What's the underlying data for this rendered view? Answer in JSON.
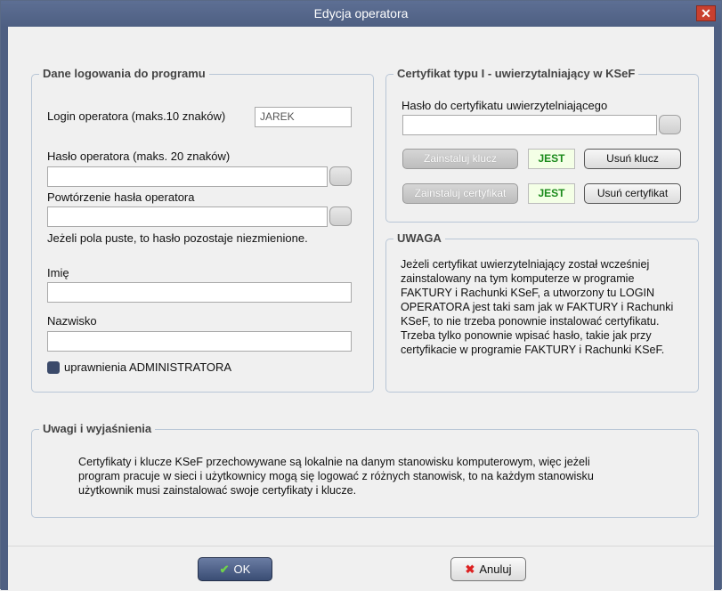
{
  "window": {
    "title": "Edycja operatora",
    "close_glyph": "✕"
  },
  "login_group": {
    "legend": "Dane logowania do programu",
    "login_label": "Login operatora (maks.10 znaków)",
    "login_value": "JAREK",
    "password_label": "Hasło operatora (maks. 20 znaków)",
    "password_value": "",
    "repeat_label": "Powtórzenie hasła operatora",
    "repeat_value": "",
    "empty_note": "Jeżeli pola puste, to hasło pozostaje niezmienione.",
    "first_name_label": "Imię",
    "first_name_value": "",
    "last_name_label": "Nazwisko",
    "last_name_value": "",
    "admin_label": "uprawnienia ADMINISTRATORA"
  },
  "cert_group": {
    "legend": "Certyfikat typu I - uwierzytalniający w KSeF",
    "cert_password_label": "Hasło do certyfikatu uwierzytelniającego",
    "cert_password_value": "",
    "install_key_label": "Zainstaluj klucz",
    "key_status": "JEST",
    "remove_key_label": "Usuń klucz",
    "install_cert_label": "Zainstaluj certyfikat",
    "cert_status": "JEST",
    "remove_cert_label": "Usuń certyfikat"
  },
  "warning_group": {
    "legend": "UWAGA",
    "lines": [
      "Jeżeli certyfikat uwierzytelniający został wcześniej",
      "zainstalowany na tym komputerze w programie",
      "FAKTURY i Rachunki  KSeF, a utworzony tu LOGIN",
      "OPERATORA jest taki sam jak w FAKTURY i Rachunki",
      "KSeF, to nie trzeba ponownie instalować certyfikatu.",
      "Trzeba tylko ponownie wpisać hasło, takie jak przy",
      "certyfikacie w programie FAKTURY i Rachunki KSeF."
    ]
  },
  "notes_group": {
    "legend": "Uwagi i wyjaśnienia",
    "lines": [
      "Certyfikaty i klucze KSeF przechowywane są lokalnie na danym stanowisku komputerowym, więc jeżeli",
      "program pracuje w sieci i użytkownicy mogą się logować z różnych stanowisk, to na każdym stanowisku",
      "użytkownik musi zainstalować swoje certyfikaty i klucze."
    ]
  },
  "footer": {
    "ok_label": "OK",
    "ok_icon": "check-icon",
    "cancel_label": "Anuluj",
    "cancel_icon": "x-icon"
  },
  "colors": {
    "titlebar": "#4e5f82",
    "status_text": "#1a8a1a",
    "ok_button": "#3a4d74"
  }
}
